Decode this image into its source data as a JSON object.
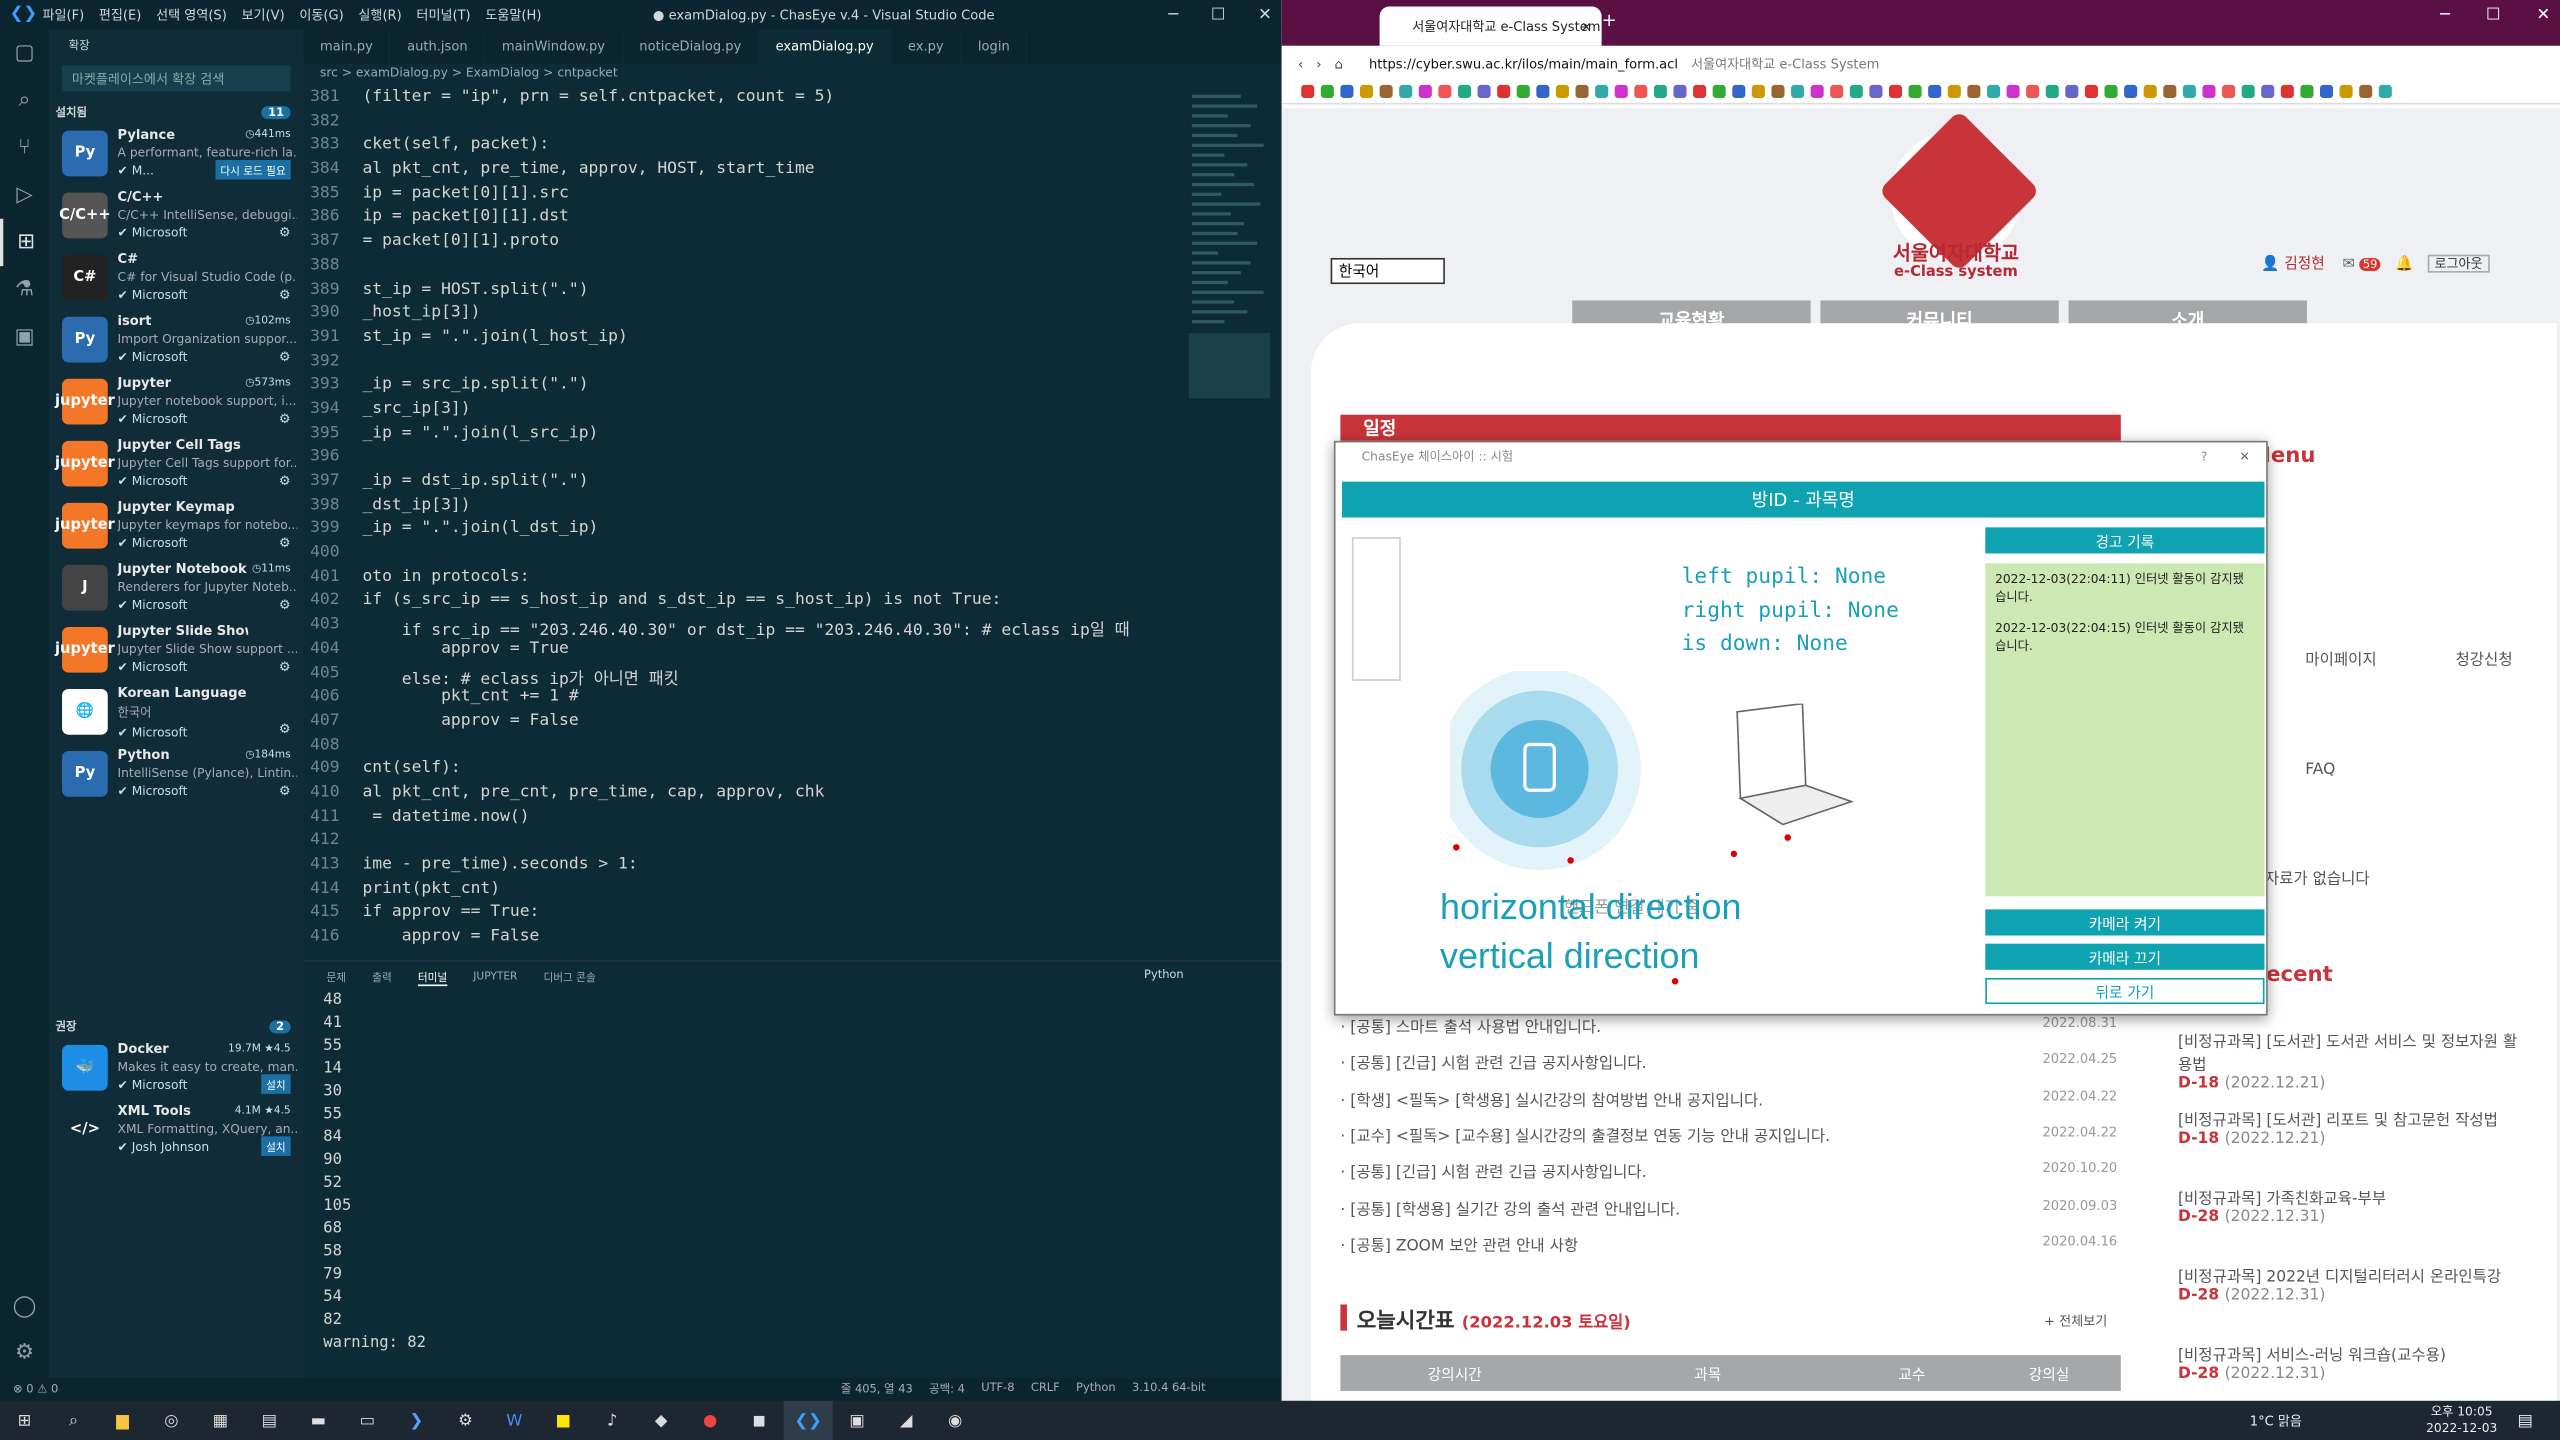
{
  "vscode": {
    "menu": [
      "파일(F)",
      "편집(E)",
      "선택 영역(S)",
      "보기(V)",
      "이동(G)",
      "실행(R)",
      "터미널(T)",
      "도움말(H)"
    ],
    "window_title": "● examDialog.py - ChasEye v.4 - Visual Studio Code",
    "sidebar": {
      "title": "확장",
      "search_placeholder": "마켓플레이스에서 확장 검색",
      "installed_label": "설치됨",
      "installed_count": "11",
      "recommended_label": "권장",
      "recommended_count": "2",
      "extensions": [
        {
          "name": "Pylance",
          "desc": "A performant, feature-rich la...",
          "pub": "M...",
          "time": "441ms",
          "btn": "다시 로드 필요",
          "color": "#2b6cb0",
          "glyph": "Py"
        },
        {
          "name": "C/C++",
          "desc": "C/C++ IntelliSense, debuggi...",
          "pub": "Microsoft",
          "time": "",
          "btn": "",
          "color": "#555",
          "glyph": "C/C++"
        },
        {
          "name": "C#",
          "desc": "C# for Visual Studio Code (p...",
          "pub": "Microsoft",
          "time": "",
          "btn": "",
          "color": "#222",
          "glyph": "C#"
        },
        {
          "name": "isort",
          "desc": "Import Organization suppor...",
          "pub": "Microsoft",
          "time": "102ms",
          "btn": "",
          "color": "#2b6cb0",
          "glyph": "Py"
        },
        {
          "name": "Jupyter",
          "desc": "Jupyter notebook support, i...",
          "pub": "Microsoft",
          "time": "573ms",
          "btn": "",
          "color": "#f37726",
          "glyph": "jupyter"
        },
        {
          "name": "Jupyter Cell Tags",
          "desc": "Jupyter Cell Tags support for...",
          "pub": "Microsoft",
          "time": "",
          "btn": "",
          "color": "#f37726",
          "glyph": "jupyter"
        },
        {
          "name": "Jupyter Keymap",
          "desc": "Jupyter keymaps for notebo...",
          "pub": "Microsoft",
          "time": "",
          "btn": "",
          "color": "#f37726",
          "glyph": "jupyter"
        },
        {
          "name": "Jupyter Notebook ...",
          "desc": "Renderers for Jupyter Noteb...",
          "pub": "Microsoft",
          "time": "11ms",
          "btn": "",
          "color": "#444",
          "glyph": "J"
        },
        {
          "name": "Jupyter Slide Show",
          "desc": "Jupyter Slide Show support ...",
          "pub": "Microsoft",
          "time": "",
          "btn": "",
          "color": "#f37726",
          "glyph": "jupyter"
        },
        {
          "name": "Korean Language Pack for...",
          "desc": "한국어",
          "pub": "Microsoft",
          "time": "",
          "btn": "",
          "color": "#fff",
          "glyph": "🌐"
        },
        {
          "name": "Python",
          "desc": "IntelliSense (Pylance), Lintin...",
          "pub": "Microsoft",
          "time": "184ms",
          "btn": "",
          "color": "#2b6cb0",
          "glyph": "Py"
        }
      ],
      "recommended": [
        {
          "name": "Docker",
          "desc": "Makes it easy to create, man...",
          "pub": "Microsoft",
          "stats": "19.7M ★4.5",
          "btn": "설치",
          "color": "#1d8ee6",
          "glyph": "🐳"
        },
        {
          "name": "XML Tools",
          "desc": "XML Formatting, XQuery, an...",
          "pub": "Josh Johnson",
          "stats": "4.1M ★4.5",
          "btn": "설치",
          "color": "#0f2c38",
          "glyph": "</>"
        }
      ]
    },
    "tabs": [
      "main.py",
      "auth.json",
      "mainWindow.py",
      "noticeDialog.py",
      "examDialog.py",
      "ex.py",
      "login"
    ],
    "breadcrumb": "src > examDialog.py > ExamDialog > cntpacket",
    "code": [
      [
        "381",
        "(filter = \"ip\", prn = self.cntpacket, count = 5)"
      ],
      [
        "382",
        ""
      ],
      [
        "383",
        "cket(self, packet):"
      ],
      [
        "384",
        "al pkt_cnt, pre_time, approv, HOST, start_time"
      ],
      [
        "385",
        "ip = packet[0][1].src"
      ],
      [
        "386",
        "ip = packet[0][1].dst"
      ],
      [
        "387",
        "= packet[0][1].proto"
      ],
      [
        "388",
        ""
      ],
      [
        "389",
        "st_ip = HOST.split(\".\")"
      ],
      [
        "390",
        "_host_ip[3])"
      ],
      [
        "391",
        "st_ip = \".\".join(l_host_ip)"
      ],
      [
        "392",
        ""
      ],
      [
        "393",
        "_ip = src_ip.split(\".\")"
      ],
      [
        "394",
        "_src_ip[3])"
      ],
      [
        "395",
        "_ip = \".\".join(l_src_ip)"
      ],
      [
        "396",
        ""
      ],
      [
        "397",
        "_ip = dst_ip.split(\".\")"
      ],
      [
        "398",
        "_dst_ip[3])"
      ],
      [
        "399",
        "_ip = \".\".join(l_dst_ip)"
      ],
      [
        "400",
        ""
      ],
      [
        "401",
        "oto in protocols:"
      ],
      [
        "402",
        "if (s_src_ip == s_host_ip and s_dst_ip == s_host_ip) is not True:"
      ],
      [
        "403",
        "    if src_ip == \"203.246.40.30\" or dst_ip == \"203.246.40.30\": # eclass ip일 때"
      ],
      [
        "404",
        "        approv = True"
      ],
      [
        "405",
        "    else: # eclass ip가 아니면 패킷"
      ],
      [
        "406",
        "        pkt_cnt += 1 #"
      ],
      [
        "407",
        "        approv = False"
      ],
      [
        "408",
        ""
      ],
      [
        "409",
        "cnt(self):"
      ],
      [
        "410",
        "al pkt_cnt, pre_cnt, pre_time, cap, approv, chk"
      ],
      [
        "411",
        " = datetime.now()"
      ],
      [
        "412",
        ""
      ],
      [
        "413",
        "ime - pre_time).seconds > 1:"
      ],
      [
        "414",
        "print(pkt_cnt)"
      ],
      [
        "415",
        "if approv == True:"
      ],
      [
        "416",
        "    approv = False"
      ]
    ],
    "panel_tabs": [
      "문제",
      "출력",
      "터미널",
      "JUPYTER",
      "디버그 콘솔"
    ],
    "terminal_lang": "Python",
    "terminal": [
      "48",
      "41",
      "55",
      "14",
      "30",
      "55",
      "84",
      "90",
      "52",
      "105",
      "68",
      "58",
      "79",
      "54",
      "82",
      "warning: 82"
    ],
    "status_left": "⊗ 0 ⚠ 0",
    "status_right": [
      "줄 405, 열 43",
      "공백: 4",
      "UTF-8",
      "CRLF",
      "Python",
      "3.10.4 64-bit"
    ]
  },
  "browser": {
    "tab_title": "서울여자대학교 e-Class System",
    "url": "https://cyber.swu.ac.kr/ilos/main/main_form.acl",
    "url_title": "서울여자대학교 e-Class System",
    "logo_name": "서울여자대학교",
    "logo_sub": "e-Class system",
    "lang": "한국어",
    "user": "김정현",
    "mail_count": "59",
    "logout": "로그아웃",
    "nav": [
      "교육현황",
      "커뮤니티",
      "소개"
    ],
    "banner": "일정",
    "menu_title": "Menu",
    "menu_items": [
      "마이페이지",
      "청강신청",
      "FAQ"
    ],
    "no_data": "조회할 자료가 없습니다",
    "recent_title": "Recent",
    "notices": [
      {
        "t": "· [공통] 스마트 출석 사용법 안내입니다.",
        "d": "2022.08.31"
      },
      {
        "t": "· [공통] [긴급] 시험 관련 긴급 공지사항입니다.",
        "d": "2022.04.25"
      },
      {
        "t": "· [학생] <필독> [학생용] 실시간강의 참여방법 안내 공지입니다.",
        "d": "2022.04.22"
      },
      {
        "t": "· [교수] <필독> [교수용] 실시간강의 출결정보 연동 기능 안내 공지입니다.",
        "d": "2022.04.22"
      },
      {
        "t": "· [공통] [긴급] 시험 관련 긴급 공지사항입니다.",
        "d": "2020.10.20"
      },
      {
        "t": "· [공통] [학생용] 실기간 강의 출석 관련 안내입니다.",
        "d": "2020.09.03"
      },
      {
        "t": "· [공통] ZOOM 보안 관련 안내 사항",
        "d": "2020.04.16"
      }
    ],
    "timetable_title": "오늘시간표",
    "timetable_date": "(2022.12.03 토요일)",
    "more": "+ 전체보기",
    "table_headers": [
      "강의시간",
      "과목",
      "교수",
      "강의실"
    ],
    "assignments": [
      {
        "t": "[비정규과목] [도서관] 도서관 서비스 및 정보자원 활용법",
        "d": "D-18",
        "date": "(2022.12.21)"
      },
      {
        "t": "[비정규과목] [도서관] 리포트 및 참고문헌 작성법",
        "d": "D-18",
        "date": "(2022.12.21)"
      },
      {
        "t": "[비정규과목] 가족친화교육-부부",
        "d": "D-28",
        "date": "(2022.12.31)"
      },
      {
        "t": "[비정규과목] 2022년 디지털리터러시 온라인특강",
        "d": "D-28",
        "date": "(2022.12.31)"
      },
      {
        "t": "[비정규과목] 서비스-러닝 워크숍(교수용)",
        "d": "D-28",
        "date": "(2022.12.31)"
      }
    ]
  },
  "dialog": {
    "title": "ChasEye 체이스아이 :: 시험",
    "header": "방ID - 과목명",
    "log_title": "경고 기록",
    "logs": [
      "2022-12-03(22:04:11) 인터넷 활동이 감지됐습니다.",
      "2022-12-03(22:04:15) 인터넷 활동이 감지됐습니다."
    ],
    "status": [
      "left pupil:  None",
      "right pupil: None",
      "is down: None"
    ],
    "hint": "핸드폰 연결 대기 중",
    "dir1": "horizontal direction",
    "dir2": "vertical direction",
    "cam_on": "카메라 켜기",
    "cam_off": "카메라 끄기",
    "back": "뒤로 가기"
  },
  "taskbar": {
    "weather": "1°C 맑음",
    "time": "오후 10:05",
    "date": "2022-12-03"
  }
}
